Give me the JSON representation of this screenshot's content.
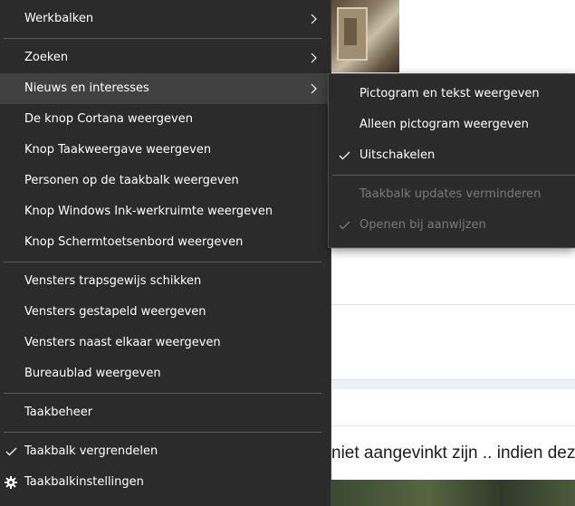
{
  "background": {
    "visible_text": "niet aangevinkt zijn .. indien dez"
  },
  "main_menu": {
    "items": [
      {
        "label": "Werkbalken",
        "submenu": true
      },
      {
        "label": "Zoeken",
        "submenu": true
      },
      {
        "label": "Nieuws en interesses",
        "submenu": true,
        "highlighted": true
      },
      {
        "label": "De knop Cortana weergeven"
      },
      {
        "label": "Knop Taakweergave weergeven"
      },
      {
        "label": "Personen op de taakbalk weergeven"
      },
      {
        "label": "Knop Windows Ink-werkruimte weergeven"
      },
      {
        "label": "Knop Schermtoetsenbord weergeven"
      },
      {
        "label": "Vensters trapsgewijs schikken"
      },
      {
        "label": "Vensters gestapeld weergeven"
      },
      {
        "label": "Vensters naast elkaar weergeven"
      },
      {
        "label": "Bureaublad weergeven"
      },
      {
        "label": "Taakbeheer"
      },
      {
        "label": "Taakbalk vergrendelen",
        "checked": true
      },
      {
        "label": "Taakbalkinstellingen",
        "icon": "gear-icon"
      }
    ]
  },
  "sub_menu": {
    "parent": "Nieuws en interesses",
    "items": [
      {
        "label": "Pictogram en tekst weergeven"
      },
      {
        "label": "Alleen pictogram weergeven"
      },
      {
        "label": "Uitschakelen",
        "checked": true
      },
      {
        "label": "Taakbalk updates verminderen",
        "disabled": true
      },
      {
        "label": "Openen bij aanwijzen",
        "disabled": true,
        "checked": true
      }
    ]
  },
  "colors": {
    "menu_background": "#2b2b2b",
    "menu_hover": "#414141",
    "menu_text": "#ffffff",
    "menu_disabled_text": "#7a7a7a",
    "separator": "#5a5a5a"
  }
}
